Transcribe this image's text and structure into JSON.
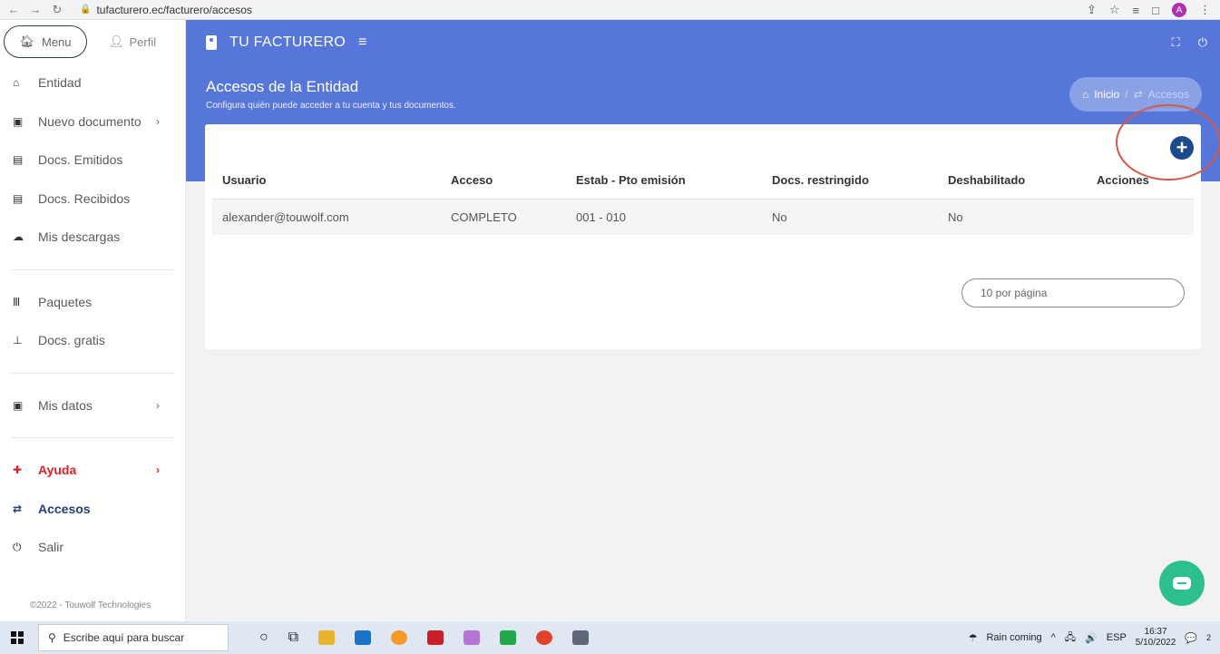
{
  "browser": {
    "url": "tufacturero.ec/facturero/accesos",
    "profile_initial": "A"
  },
  "sidebar": {
    "menu_label": "Menu",
    "perfil_label": "Perfil",
    "items": [
      {
        "label": "Entidad",
        "icon": "home-icon"
      },
      {
        "label": "Nuevo documento",
        "icon": "plus-square-icon"
      },
      {
        "label": "Docs. Emitidos",
        "icon": "document-icon"
      },
      {
        "label": "Docs. Recibidos",
        "icon": "document-icon"
      },
      {
        "label": "Mis descargas",
        "icon": "cloud-download-icon"
      }
    ],
    "items2": [
      {
        "label": "Paquetes",
        "icon": "bars-icon"
      },
      {
        "label": "Docs. gratis",
        "icon": "gift-icon"
      }
    ],
    "items3": [
      {
        "label": "Mis datos",
        "icon": "plus-square-icon"
      }
    ],
    "items4": [
      {
        "label": "Ayuda",
        "icon": "help-icon"
      },
      {
        "label": "Accesos",
        "icon": "exchange-icon"
      },
      {
        "label": "Salir",
        "icon": "power-icon"
      }
    ],
    "copyright": "©2022 - Touwolf Technologies"
  },
  "topbar": {
    "brand": "TU FACTURERO"
  },
  "header": {
    "title": "Accesos de la Entidad",
    "subtitle": "Configura quién puede acceder a tu cuenta y tus documentos.",
    "breadcrumb_home": "Inicio",
    "breadcrumb_sep": "/",
    "breadcrumb_current": "Accesos"
  },
  "table": {
    "columns": [
      "Usuario",
      "Acceso",
      "Estab - Pto emisión",
      "Docs. restringido",
      "Deshabilitado",
      "Acciones"
    ],
    "rows": [
      [
        "alexander@touwolf.com",
        "COMPLETO",
        "001 - 010",
        "No",
        "No",
        ""
      ]
    ]
  },
  "pager": {
    "label": "10 por página"
  },
  "taskbar": {
    "search_placeholder": "Escribe aquí para buscar",
    "weather": "Rain coming",
    "lang": "ESP",
    "time": "16:37",
    "date": "5/10/2022",
    "notifications": "2"
  },
  "colors": {
    "header_blue": "#5677d9",
    "add_button": "#1c4a8f",
    "annotation_red": "#d35a49",
    "chat_green": "#2ebf91",
    "help_red": "#e0202a"
  }
}
